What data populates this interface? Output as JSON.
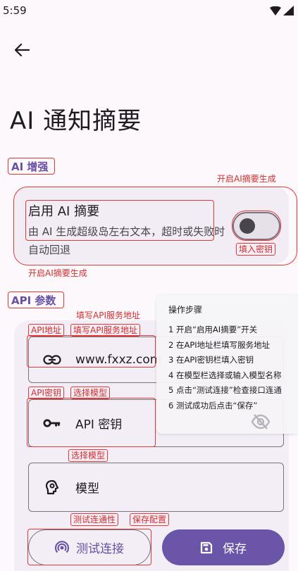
{
  "status_bar": {
    "time": "5:59",
    "icons": [
      "wifi-icon",
      "signal-icon"
    ]
  },
  "header": {
    "back_icon": "arrow-back-icon",
    "title": "AI 通知摘要"
  },
  "ai_section": {
    "heading": "AI 增强",
    "card": {
      "title": "启用 AI 摘要",
      "description": "由 AI 生成超级岛左右文本，超时或失败时自动回退",
      "switch_on": false
    }
  },
  "api_section": {
    "heading": "API 参数",
    "url_field": {
      "icon": "link-icon",
      "value": "www.fxxz.com"
    },
    "key_field": {
      "icon": "key-icon",
      "placeholder": "API 密钥",
      "trailing_icon": "eye-off-icon"
    },
    "model_field": {
      "icon": "model-icon",
      "placeholder": "模型"
    },
    "test_button": {
      "icon": "connection-icon",
      "label": "测试连接"
    },
    "save_button": {
      "icon": "save-icon",
      "label": "保存"
    }
  },
  "steps_panel": {
    "title": "操作步骤",
    "steps": [
      "1 开启“启用AI摘要”开关",
      "2 在API地址栏填写服务地址",
      "3 在API密钥栏填入密钥",
      "4 在模型栏选择或输入模型名称",
      "5 点击“测试连接”检查接口连通",
      "6 测试成功后点击“保存”"
    ]
  },
  "annotations": {
    "enable_ai_top": "开启AI摘要生成",
    "fill_key": "填入密钥",
    "enable_ai_bottom": "开启AI摘要生成",
    "fill_url_top": "填写API服务地址",
    "api_url_tag": "API地址",
    "fill_url": "填写API服务地址",
    "api_key_tag": "API密钥",
    "choose_model_1": "选择模型",
    "choose_model_2": "选择模型",
    "test_connectivity": "测试连通性",
    "save_config": "保存配置"
  },
  "colors": {
    "accent": "#6750a4",
    "annotation": "#e53935",
    "save_button": "#6a55a8"
  }
}
